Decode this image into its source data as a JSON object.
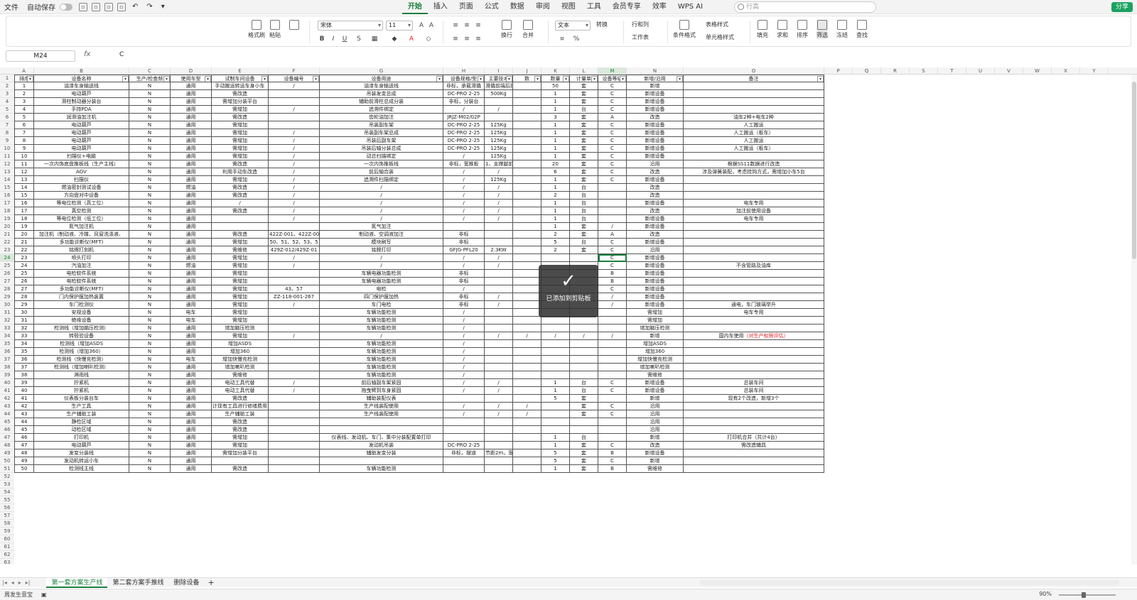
{
  "menubar": {
    "file": "文件",
    "autosave": "自动保存",
    "tabs": [
      "开始",
      "插入",
      "页面",
      "公式",
      "数据",
      "审阅",
      "视图",
      "工具",
      "会员专享",
      "效率"
    ],
    "active_tab": "开始",
    "wps_ai": "WPS AI",
    "search_placeholder": "行高",
    "share": "分享"
  },
  "ribbon": {
    "format_brush": "格式刷",
    "paste": "粘贴",
    "font_name": "宋体",
    "font_size": "11",
    "number_format": "文本",
    "convert": "转换",
    "row_col": "行和列",
    "table_style": "表格样式",
    "worksheet": "工作表",
    "cond_format": "条件格式",
    "cell_style": "单元格样式",
    "wrap": "换行",
    "merge": "合并",
    "fill": "填充",
    "sum": "求和",
    "sort": "排序",
    "filter": "筛选",
    "freeze": "冻结",
    "find": "查找"
  },
  "formula_bar": {
    "cell_ref": "M24",
    "fx": "fx",
    "value": "C"
  },
  "columns": [
    "A",
    "B",
    "C",
    "D",
    "E",
    "F",
    "G",
    "H",
    "I",
    "J",
    "K",
    "L",
    "M",
    "N",
    "O",
    "P",
    "Q",
    "R",
    "S",
    "T",
    "U",
    "V",
    "W",
    "X",
    "Y"
  ],
  "headers": [
    "排序",
    "设备名称",
    "生产/检查频",
    "使用车型",
    "试制车间设备",
    "设备编号",
    "设备用途",
    "设备规格/型",
    "主要技术",
    "数",
    "数量",
    "计量单",
    "设备等级",
    "新增/沿用",
    "备注"
  ],
  "rows": [
    [
      "1",
      "油漆车身输送线",
      "N",
      "通用",
      "手动搬运转运车身小车",
      "/",
      "油漆车身输送线",
      "非标，承载滑撬",
      "滑撬前端后抵，前支点",
      "",
      "50",
      "套",
      "C",
      "新增",
      ""
    ],
    [
      "2",
      "电动葫芦",
      "N",
      "通用",
      "需改造",
      "",
      "吊装发变总成",
      "DC-PRO 2-25",
      "500Kg",
      "",
      "1",
      "套",
      "C",
      "新增设备",
      ""
    ],
    [
      "3",
      "滑柱制动器分装台",
      "N",
      "通用",
      "需增加分装平台",
      "",
      "辅助前滑柱总成分装",
      "非标，分装台",
      "",
      "",
      "1",
      "套",
      "C",
      "新增设备",
      ""
    ],
    [
      "4",
      "手持PDA",
      "N",
      "通用",
      "需增加",
      "/",
      "追溯件绑定",
      "/",
      "/",
      "",
      "1",
      "台",
      "C",
      "新增设备",
      ""
    ],
    [
      "5",
      "润滑油加注机",
      "N",
      "通用",
      "需改造",
      "",
      "齿轮油加注",
      "JRJZ-M02/02P",
      "",
      "",
      "3",
      "套",
      "A",
      "改造",
      "油车2种+电车2种"
    ],
    [
      "6",
      "电动葫芦",
      "N",
      "通用",
      "需增加",
      "",
      "吊装副车架",
      "DC-PRO 2-25",
      "125Kg",
      "",
      "1",
      "套",
      "C",
      "新增设备",
      "人工搬运"
    ],
    [
      "7",
      "电动葫芦",
      "N",
      "通用",
      "需增加",
      "/",
      "吊装副车架总成",
      "DC-PRO 2-25",
      "125Kg",
      "",
      "1",
      "套",
      "C",
      "新增设备",
      "人工搬运（板车）"
    ],
    [
      "8",
      "电动葫芦",
      "N",
      "通用",
      "需增加",
      "/",
      "吊装后副车架",
      "DC-PRO 2-25",
      "125Kg",
      "",
      "1",
      "套",
      "C",
      "新增设备",
      "人工搬运"
    ],
    [
      "9",
      "电动葫芦",
      "N",
      "通用",
      "需增加",
      "/",
      "吊装后轴分装总成",
      "DC-PRO 2-25",
      "125Kg",
      "",
      "1",
      "套",
      "C",
      "新增设备",
      "人工搬运（板车）"
    ],
    [
      "10",
      "扫描仪+电脑",
      "N",
      "通用",
      "需增加",
      "/",
      "动总扫描绑定",
      "/",
      "125Kg",
      "",
      "1",
      "套",
      "C",
      "新增设备",
      ""
    ],
    [
      "11",
      "一次内饰底盘推板线（生产主线）",
      "N",
      "通用",
      "需改造",
      "/",
      "一次内饰推板线",
      "非标，宽推板",
      "1、支撑腿前支点中心",
      "",
      "20",
      "套",
      "C",
      "沿用",
      "根据SS11数据进行改造"
    ],
    [
      "12",
      "AGV",
      "N",
      "通用",
      "利用手动车改造",
      "/",
      "前后轴合装",
      "/",
      "/",
      "",
      "6",
      "套",
      "C",
      "改造",
      "涉及弹簧装配，考虑挂钩方式，需增加小车5台"
    ],
    [
      "13",
      "扫描仪",
      "N",
      "通用",
      "需增加",
      "/",
      "追溯件扫描绑定",
      "/",
      "125Kg",
      "",
      "1",
      "套",
      "C",
      "新增设备",
      ""
    ],
    [
      "14",
      "燃油密封测试设备",
      "N",
      "燃油",
      "需改造",
      "/",
      "/",
      "/",
      "/",
      "",
      "1",
      "台",
      "",
      "改造",
      ""
    ],
    [
      "15",
      "方向盘对中设备",
      "N",
      "通用",
      "需改造",
      "/",
      "/",
      "/",
      "/",
      "",
      "2",
      "台",
      "",
      "改造",
      ""
    ],
    [
      "16",
      "等电位检测（高工位）",
      "N",
      "通用",
      "/",
      "/",
      "/",
      "/",
      "/",
      "",
      "1",
      "台",
      "",
      "新增设备",
      "电车专用"
    ],
    [
      "17",
      "真空检测",
      "N",
      "通用",
      "需改造",
      "/",
      "/",
      "/",
      "/",
      "",
      "1",
      "台",
      "",
      "改造",
      "加注前使用设备"
    ],
    [
      "18",
      "等电位检测（低工位）",
      "N",
      "通用",
      "",
      "/",
      "/",
      "/",
      "/",
      "",
      "1",
      "台",
      "",
      "新增设备",
      "电车专用"
    ],
    [
      "19",
      "氮气加注机",
      "N",
      "通用",
      "",
      "",
      "氮气加注",
      "",
      "",
      "",
      "1",
      "套",
      "/",
      "新增设备",
      ""
    ],
    [
      "20",
      "加注机（制动液、冷媒、风窗洗涤液、",
      "N",
      "通用",
      "需改造",
      "422Z-001、422Z-00",
      "制动液、空调液加注",
      "非标",
      "",
      "",
      "2",
      "套",
      "A",
      "改造",
      ""
    ],
    [
      "21",
      "多功能诊断仪(MFT)",
      "N",
      "通用",
      "需增加",
      "50、51、52、53、5",
      "模块刷写",
      "非标",
      "",
      "",
      "5",
      "台",
      "C",
      "新增设备",
      ""
    ],
    [
      "22",
      "铭牌打刻机",
      "N",
      "通用",
      "需维修",
      "429Z-012/429Z-01",
      "铭牌打印",
      "GFJG-PFL20",
      "2.3KW",
      "",
      "2",
      "套",
      "C",
      "沿用",
      ""
    ],
    [
      "23",
      "喷头打印",
      "N",
      "通用",
      "需增加",
      "/",
      "/",
      "/",
      "/",
      "",
      "",
      "",
      "C",
      "新增设备",
      ""
    ],
    [
      "24",
      "汽油加注",
      "N",
      "燃油",
      "需增加",
      "/",
      "/",
      "/",
      "/",
      "",
      "",
      "",
      "C",
      "新增设备",
      "不含管路及油库"
    ],
    [
      "25",
      "电检软件系统",
      "N",
      "通用",
      "需增加",
      "",
      "车辆电器功能检测",
      "非标",
      "",
      "",
      "",
      "",
      "B",
      "新增设备",
      ""
    ],
    [
      "26",
      "电检软件系统",
      "N",
      "通用",
      "需增加",
      "",
      "车辆电器功能检测",
      "非标",
      "",
      "",
      "",
      "",
      "B",
      "新增设备",
      ""
    ],
    [
      "27",
      "多功能诊断仪(MFT)",
      "N",
      "通用",
      "需增加",
      "43、57",
      "电检",
      "/",
      "",
      "",
      "",
      "",
      "C",
      "新增设备",
      ""
    ],
    [
      "28",
      "门内保护膜加热装置",
      "N",
      "通用",
      "需增加",
      "ZZ-118-001-267",
      "四门保护膜加热",
      "非标",
      "/",
      "",
      "",
      "",
      "/",
      "新增设备",
      ""
    ],
    [
      "29",
      "车门检测仪",
      "N",
      "通用",
      "需增加",
      "/",
      "车门电检",
      "非标",
      "/",
      "",
      "",
      "",
      "/",
      "新增设备",
      "通电，车门玻璃举升"
    ],
    [
      "30",
      "安规设备",
      "N",
      "电车",
      "需增加",
      "",
      "车辆功能检测",
      "/",
      "",
      "",
      "",
      "",
      "",
      "需增加",
      "电车专用"
    ],
    [
      "31",
      "绝缘设备",
      "N",
      "电车",
      "需增加",
      "",
      "车辆功能检测",
      "/",
      "",
      "",
      "",
      "",
      "",
      "需增加",
      ""
    ],
    [
      "32",
      "检测线（增加脑压检测）",
      "N",
      "通用",
      "增加脑压检测",
      "",
      "车辆功能检测",
      "/",
      "",
      "",
      "",
      "",
      "",
      "增加脑压检测",
      ""
    ],
    [
      "33",
      "转毂验设备",
      "N",
      "通用",
      "需增加",
      "/",
      "/",
      "/",
      "/",
      "/",
      "/",
      "/",
      "/",
      "新增",
      "国内车使用（对生产权限评估）"
    ],
    [
      "34",
      "检测线（增加ASDS",
      "N",
      "通用",
      "增加ASDS",
      "",
      "车辆功能检测",
      "/",
      "",
      "",
      "",
      "",
      "",
      "增加ASDS",
      ""
    ],
    [
      "35",
      "检测线（增加360）",
      "N",
      "通用",
      "增加360",
      "",
      "车辆功能检测",
      "/",
      "",
      "",
      "",
      "",
      "",
      "增加360",
      ""
    ],
    [
      "36",
      "检测线（快慢充检测）",
      "N",
      "电车",
      "增加快慢充检测",
      "",
      "车辆功能检测",
      "/",
      "",
      "",
      "",
      "",
      "",
      "增加快慢充检测",
      ""
    ],
    [
      "37",
      "检测线（增加喇叭检测）",
      "N",
      "通用",
      "增加喇叭检测",
      "",
      "车辆功能检测",
      "/",
      "",
      "",
      "",
      "",
      "",
      "增加喇叭检测",
      ""
    ],
    [
      "38",
      "淋雨线",
      "N",
      "通用",
      "需维修",
      "",
      "车辆功能检测",
      "/",
      "",
      "",
      "",
      "",
      "",
      "需维修",
      ""
    ],
    [
      "39",
      "拧紧机",
      "N",
      "通用",
      "电动工具代替",
      "/",
      "前后轴副车架紧固",
      "/",
      "/",
      "",
      "1",
      "台",
      "C",
      "新增设备",
      "总装车间"
    ],
    [
      "40",
      "拧紧机",
      "N",
      "通用",
      "电动工具代替",
      "/",
      "拖曳臂到车身紧固",
      "/",
      "/",
      "",
      "1",
      "台",
      "C",
      "新增设备",
      "总装车间"
    ],
    [
      "41",
      "仪表板分装台车",
      "N",
      "通用",
      "需改造",
      "",
      "辅助装配仪表",
      "",
      "",
      "",
      "5",
      "套",
      "",
      "新增",
      "现有2个改造，新增3个"
    ],
    [
      "42",
      "生产工具",
      "N",
      "通用",
      "计现有工具进行修缮费用",
      "",
      "生产线装配使用",
      "/",
      "/",
      "/",
      "",
      "套",
      "C",
      "沿用",
      ""
    ],
    [
      "43",
      "生产辅助工装",
      "N",
      "通用",
      "生产辅助工装",
      "",
      "生产线装配使用",
      "/",
      "/",
      "/",
      "",
      "套",
      "C",
      "沿用",
      ""
    ],
    [
      "44",
      "静检区域",
      "N",
      "通用",
      "需改造",
      "",
      "",
      "",
      "",
      "",
      "",
      "",
      "",
      "沿用",
      ""
    ],
    [
      "45",
      "动检区域",
      "N",
      "通用",
      "需改造",
      "",
      "",
      "",
      "",
      "",
      "",
      "",
      "",
      "沿用",
      ""
    ],
    [
      "46",
      "打印机",
      "N",
      "通用",
      "需增加",
      "",
      "仪表线、发动机、车门、集中分装配置单打印",
      "",
      "",
      "",
      "1",
      "台",
      "",
      "新增",
      "打印机合并（共计4台）"
    ],
    [
      "47",
      "电动葫芦",
      "N",
      "通用",
      "需增加",
      "",
      "发动机吊装",
      "DC-PRO 2-25",
      "",
      "",
      "1",
      "套",
      "C",
      "改造",
      "需改造辅具"
    ],
    [
      "48",
      "发变分装线",
      "N",
      "通用",
      "需增加分装平台",
      "",
      "辅助发变分装",
      "非标，摆道",
      "节距2m，宽度800mm",
      "",
      "5",
      "套",
      "B",
      "新增设备",
      ""
    ],
    [
      "49",
      "发动机转运小车",
      "N",
      "通用",
      "",
      "",
      "",
      "",
      "",
      "",
      "5",
      "套",
      "C",
      "新增",
      ""
    ],
    [
      "50",
      "检测线主线",
      "N",
      "通用",
      "需改造",
      "",
      "车辆功能检测",
      "",
      "",
      "",
      "1",
      "套",
      "B",
      "需维修",
      ""
    ]
  ],
  "row_numbers": [
    "1",
    "2",
    "3",
    "4",
    "5",
    "6",
    "7",
    "8",
    "9",
    "10",
    "11",
    "12",
    "13",
    "14",
    "15",
    "16",
    "17",
    "18",
    "19",
    "20",
    "21",
    "22",
    "23",
    "24",
    "25",
    "26",
    "27",
    "28",
    "29",
    "30",
    "31",
    "32",
    "33",
    "34",
    "35",
    "36",
    "37",
    "38",
    "39",
    "40",
    "41",
    "42",
    "43",
    "44",
    "45",
    "46",
    "47",
    "48",
    "49",
    "50",
    "51",
    "52",
    "53",
    "54",
    "55",
    "56",
    "57",
    "58",
    "59",
    "60",
    "61",
    "62",
    "63"
  ],
  "toast": {
    "message": "已添加到剪贴板"
  },
  "sheets": [
    "第一套方案生产线",
    "第二套方案手推线",
    "删除设备"
  ],
  "active_sheet": "第一套方案生产线",
  "status": {
    "left": "周发生意宝",
    "zoom": "90%"
  },
  "colors": {
    "accent": "#1a7f3c",
    "share": "#1aa260",
    "red_text": "#e02020"
  }
}
